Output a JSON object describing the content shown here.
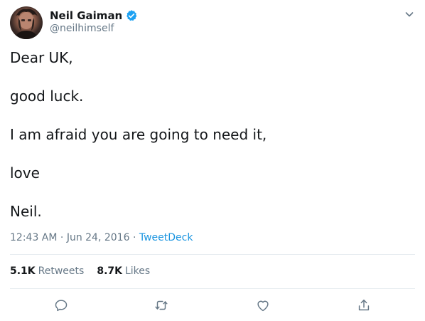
{
  "author": {
    "display_name": "Neil Gaiman",
    "handle": "@neilhimself",
    "verified": true,
    "avatar_icon": "avatar-photo"
  },
  "tweet": {
    "lines": [
      "Dear UK,",
      "good luck.",
      "I am afraid you are going to need it,",
      "love",
      "Neil."
    ]
  },
  "meta": {
    "time": "12:43 AM",
    "separator": "·",
    "date": "Jun 24, 2016",
    "source": "TweetDeck"
  },
  "stats": {
    "retweets_count": "5.1K",
    "retweets_label": "Retweets",
    "likes_count": "8.7K",
    "likes_label": "Likes"
  },
  "actions": [
    "reply-icon",
    "retweet-icon",
    "like-icon",
    "share-icon"
  ],
  "colors": {
    "accent": "#1b95e0",
    "verified": "#1da1f2",
    "muted": "#657786",
    "text": "#14171a",
    "divider": "#e6ecf0"
  }
}
